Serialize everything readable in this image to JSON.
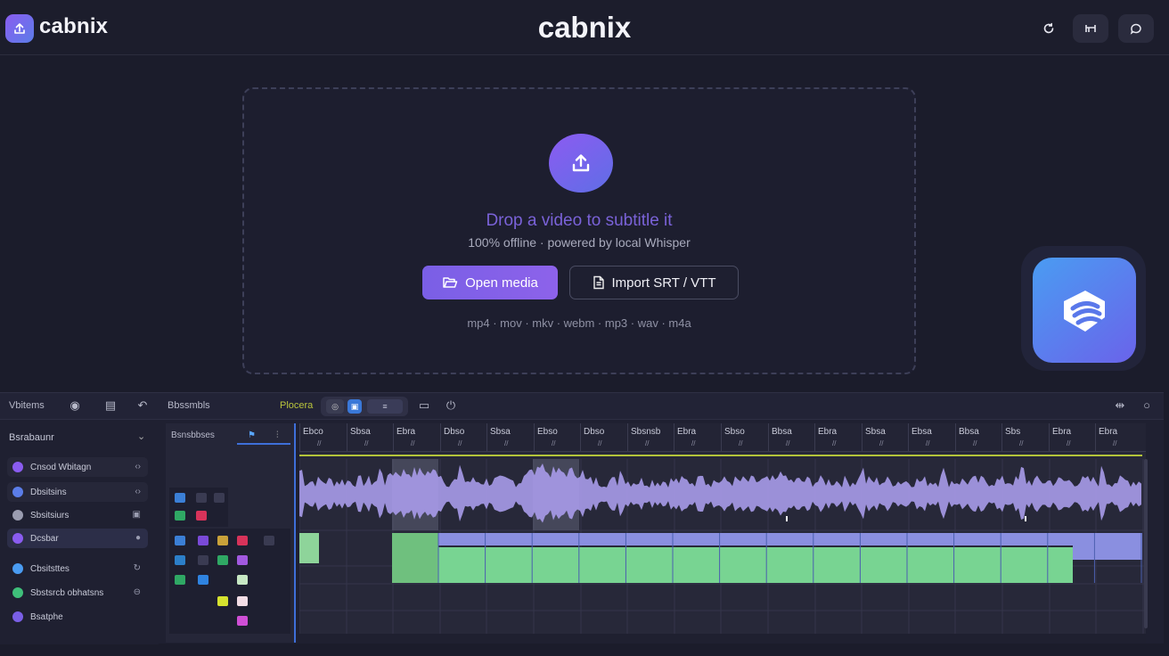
{
  "brand": {
    "name": "cabnix",
    "center_title": "cabnix",
    "accent": "#7b5fe6",
    "secondary": "#4a9cf2"
  },
  "topbar": {
    "icons": [
      "refresh-icon",
      "layout-icon",
      "chat-icon"
    ]
  },
  "dropzone": {
    "title": "Drop a video to subtitle it",
    "subtitle": "100% offline · powered by local Whisper",
    "open_button": "Open media",
    "import_button": "Import SRT / VTT",
    "formats": "mp4 · mov · mkv · webm · mp3 · wav · m4a"
  },
  "editor": {
    "toolbar": {
      "left_label": "Vbitems",
      "center_label": "Bbssmbls",
      "mode_label": "Plocera"
    },
    "sidebar": {
      "header": "Bsrabaunr",
      "items": [
        {
          "label": "Cnsod Wbitagn",
          "color": "#8a5cf0"
        },
        {
          "label": "Dbsitsins",
          "color": "#5b7de8"
        },
        {
          "label": "Sbsitsiurs",
          "color": "#9a9cb0"
        },
        {
          "label": "Dcsbar",
          "color": "#8a5cf0"
        },
        {
          "label": "Cbsitsttes",
          "color": "#4a9cf2"
        },
        {
          "label": "Sbstsrcb obhatsns",
          "color": "#3fbf7a"
        },
        {
          "label": "Bsatphe",
          "color": "#7a5fe6"
        }
      ]
    },
    "track_header_label": "Bsnsbbses",
    "ruler_ticks": [
      "Ebco",
      "Sbsa",
      "Ebra",
      "Dbso",
      "Sbsa",
      "Ebso",
      "Dbso",
      "Sbsnsb",
      "Ebra",
      "Sbso",
      "Bbsa",
      "Ebra",
      "Sbsa",
      "Ebsa",
      "Bbsa",
      "Sbs",
      "Ebra",
      "Ebra"
    ]
  }
}
